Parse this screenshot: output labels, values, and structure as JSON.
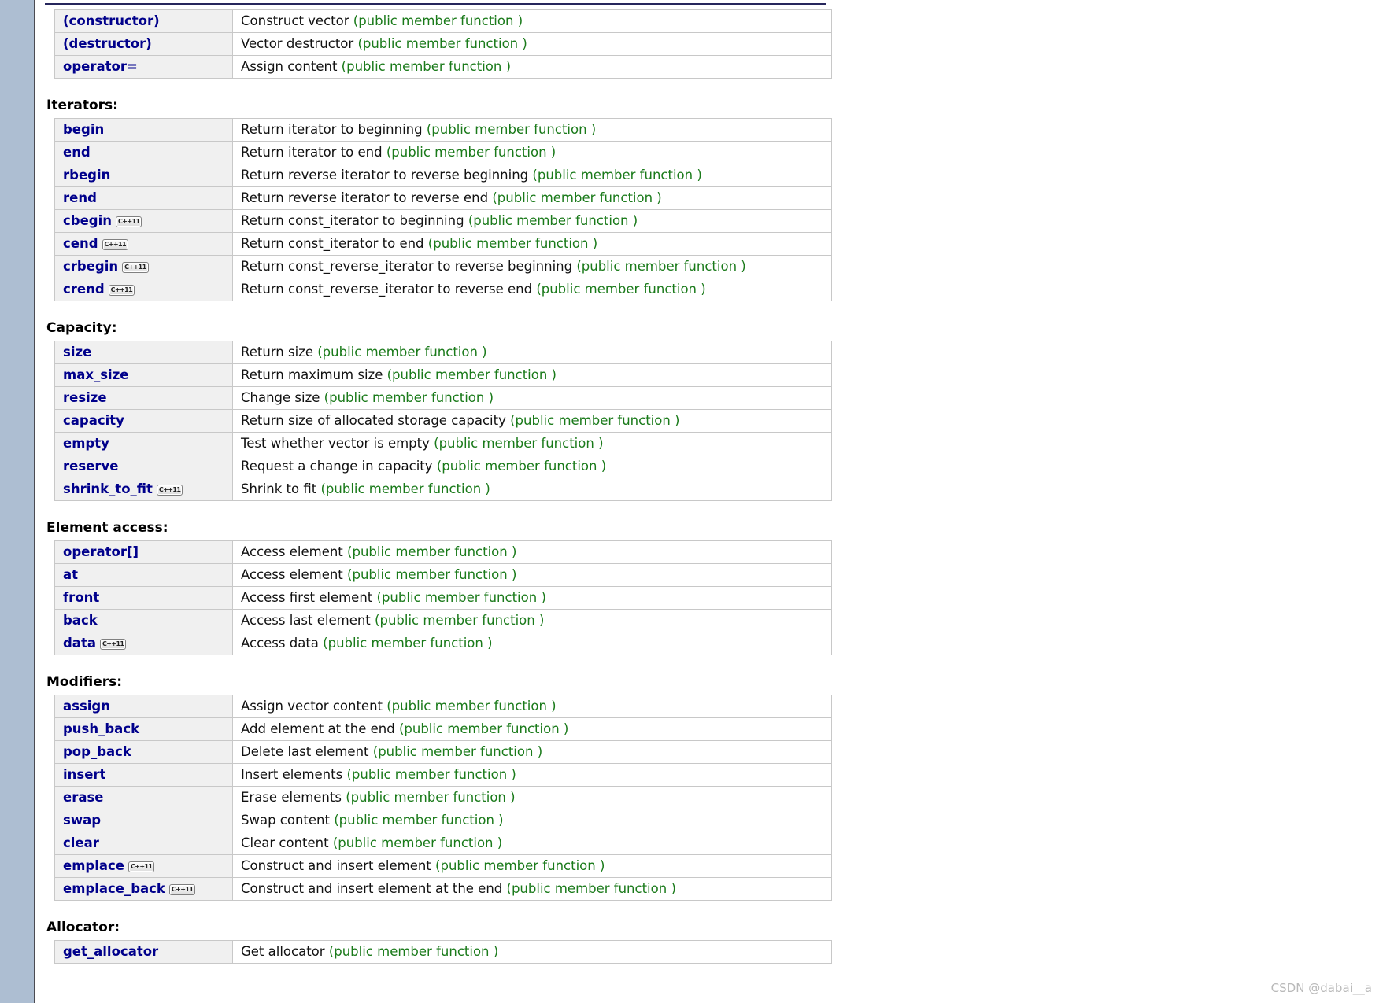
{
  "watermark": "CSDN @dabai__a",
  "badge_label": "C++11",
  "note_text": "(public member function )",
  "sections": [
    {
      "title": "",
      "show_title": false,
      "rows": [
        {
          "name": "(constructor)",
          "badge": false,
          "desc": "Construct vector"
        },
        {
          "name": "(destructor)",
          "badge": false,
          "desc": "Vector destructor"
        },
        {
          "name": "operator=",
          "badge": false,
          "desc": "Assign content"
        }
      ]
    },
    {
      "title": "Iterators:",
      "show_title": true,
      "rows": [
        {
          "name": "begin",
          "badge": false,
          "desc": "Return iterator to beginning"
        },
        {
          "name": "end",
          "badge": false,
          "desc": "Return iterator to end"
        },
        {
          "name": "rbegin",
          "badge": false,
          "desc": "Return reverse iterator to reverse beginning"
        },
        {
          "name": "rend",
          "badge": false,
          "desc": "Return reverse iterator to reverse end"
        },
        {
          "name": "cbegin",
          "badge": true,
          "desc": "Return const_iterator to beginning"
        },
        {
          "name": "cend",
          "badge": true,
          "desc": "Return const_iterator to end"
        },
        {
          "name": "crbegin",
          "badge": true,
          "desc": "Return const_reverse_iterator to reverse beginning"
        },
        {
          "name": "crend",
          "badge": true,
          "desc": "Return const_reverse_iterator to reverse end"
        }
      ]
    },
    {
      "title": "Capacity:",
      "show_title": true,
      "rows": [
        {
          "name": "size",
          "badge": false,
          "desc": "Return size"
        },
        {
          "name": "max_size",
          "badge": false,
          "desc": "Return maximum size"
        },
        {
          "name": "resize",
          "badge": false,
          "desc": "Change size"
        },
        {
          "name": "capacity",
          "badge": false,
          "desc": "Return size of allocated storage capacity"
        },
        {
          "name": "empty",
          "badge": false,
          "desc": "Test whether vector is empty"
        },
        {
          "name": "reserve",
          "badge": false,
          "desc": "Request a change in capacity"
        },
        {
          "name": "shrink_to_fit",
          "badge": true,
          "desc": "Shrink to fit"
        }
      ]
    },
    {
      "title": "Element access:",
      "show_title": true,
      "rows": [
        {
          "name": "operator[]",
          "badge": false,
          "desc": "Access element"
        },
        {
          "name": "at",
          "badge": false,
          "desc": "Access element"
        },
        {
          "name": "front",
          "badge": false,
          "desc": "Access first element"
        },
        {
          "name": "back",
          "badge": false,
          "desc": "Access last element"
        },
        {
          "name": "data",
          "badge": true,
          "desc": "Access data"
        }
      ]
    },
    {
      "title": "Modifiers:",
      "show_title": true,
      "rows": [
        {
          "name": "assign",
          "badge": false,
          "desc": "Assign vector content"
        },
        {
          "name": "push_back",
          "badge": false,
          "desc": "Add element at the end"
        },
        {
          "name": "pop_back",
          "badge": false,
          "desc": "Delete last element"
        },
        {
          "name": "insert",
          "badge": false,
          "desc": "Insert elements"
        },
        {
          "name": "erase",
          "badge": false,
          "desc": "Erase elements"
        },
        {
          "name": "swap",
          "badge": false,
          "desc": "Swap content"
        },
        {
          "name": "clear",
          "badge": false,
          "desc": "Clear content"
        },
        {
          "name": "emplace",
          "badge": true,
          "desc": "Construct and insert element"
        },
        {
          "name": "emplace_back",
          "badge": true,
          "desc": "Construct and insert element at the end"
        }
      ]
    },
    {
      "title": "Allocator:",
      "show_title": true,
      "rows": [
        {
          "name": "get_allocator",
          "badge": false,
          "desc": "Get allocator"
        }
      ]
    }
  ]
}
